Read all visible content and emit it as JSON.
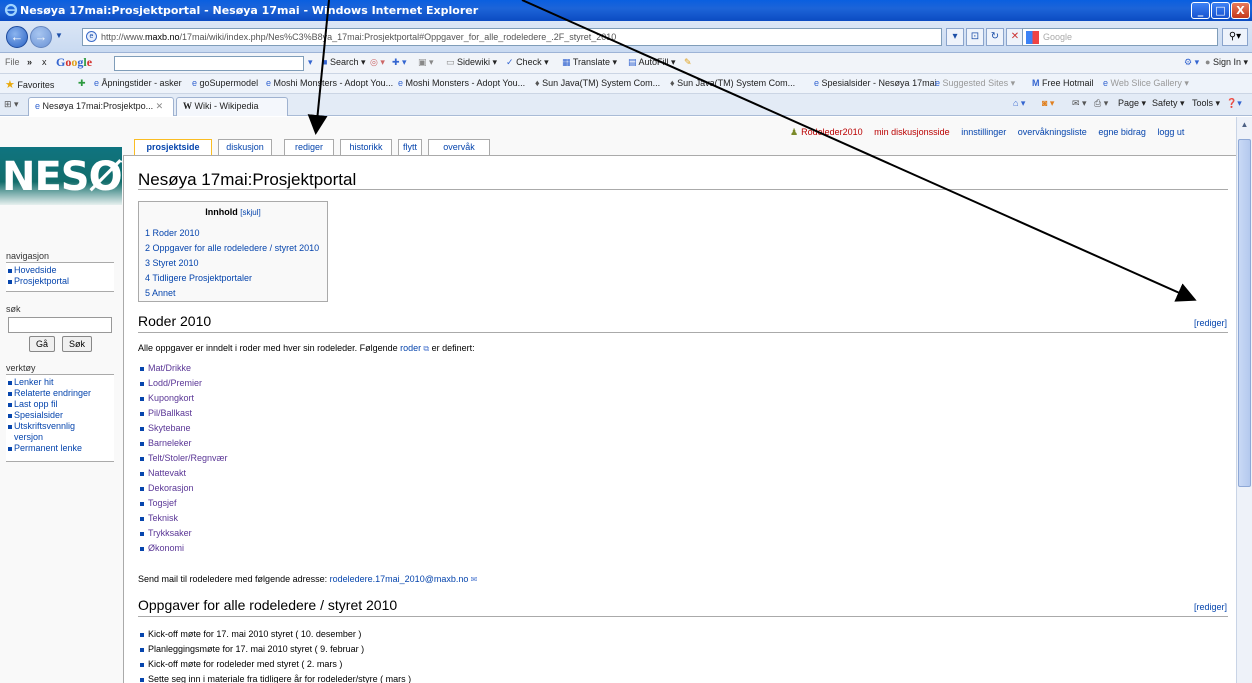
{
  "window": {
    "title": "Nesøya 17mai:Prosjektportal - Nesøya 17mai - Windows Internet Explorer",
    "min": "_",
    "max": "□",
    "close": "X"
  },
  "addressbar": {
    "url_prefix": "http://www.",
    "url_domain": "maxb.no",
    "url_rest": "/17mai/wiki/index.php/Nes%C3%B8ya_17mai:Prosjektportal#Oppgaver_for_alle_rodeledere_.2F_styret_2010",
    "search_placeholder": "Google"
  },
  "toolbar": {
    "file": "File",
    "more": "»",
    "close_x": "x",
    "google_logo": [
      "G",
      "o",
      "o",
      "g",
      "l",
      "e"
    ],
    "search": "Search",
    "sidewiki": "Sidewiki",
    "check": "Check",
    "translate": "Translate",
    "autofill": "AutoFill",
    "sign_in": "Sign In"
  },
  "favorites": {
    "label": "Favorites",
    "items": [
      "Åpningstider - asker",
      "goSupermodel",
      "Moshi Monsters - Adopt You...",
      "Moshi Monsters - Adopt You...",
      "Sun Java(TM) System Com...",
      "Sun Java(TM) System Com...",
      "Spesialsider - Nesøya 17mai",
      "Suggested Sites",
      "Free Hotmail",
      "Web Slice Gallery"
    ]
  },
  "tabs": {
    "items": [
      "Nesøya 17mai:Prosjektpo...",
      "Wiki - Wikipedia"
    ],
    "page": "Page",
    "safety": "Safety",
    "tools": "Tools"
  },
  "personal": {
    "items": [
      "Rodeleder2010",
      "min diskusjonsside",
      "innstillinger",
      "overvåkningsliste",
      "egne bidrag",
      "logg ut"
    ]
  },
  "logo": {
    "text": "NESØYA"
  },
  "page_tabs": [
    "prosjektside",
    "diskusjon",
    "rediger",
    "historikk",
    "flytt",
    "overvåk"
  ],
  "sidebar": {
    "nav_heading": "navigasjon",
    "nav_items": [
      "Hovedside",
      "Prosjektportal"
    ],
    "search_heading": "søk",
    "go": "Gå",
    "search": "Søk",
    "tools_heading": "verktøy",
    "tools_items": [
      "Lenker hit",
      "Relaterte endringer",
      "Last opp fil",
      "Spesialsider",
      "Utskriftsvennlig",
      "versjon",
      "Permanent lenke"
    ]
  },
  "content": {
    "title": "Nesøya 17mai:Prosjektportal",
    "toc": {
      "title": "Innhold",
      "hide": "[skjul]",
      "items": [
        "1 Roder 2010",
        "2 Oppgaver for alle rodeledere / styret 2010",
        "3 Styret 2010",
        "4 Tidligere Prosjektportaler",
        "5 Annet"
      ]
    },
    "section1": {
      "heading": "Roder 2010",
      "edit": "[rediger]",
      "intro_before": "Alle oppgaver er inndelt i roder med hver sin rodeleder. Følgende",
      "intro_link": "roder",
      "intro_after": "er definert:",
      "items": [
        "Mat/Drikke",
        "Lodd/Premier",
        "Kupongkort",
        "Pil/Ballkast",
        "Skytebane",
        "Barneleker",
        "Telt/Stoler/Regnvær",
        "Nattevakt",
        "Dekorasjon",
        "Togsjef",
        "Teknisk",
        "Trykksaker",
        "Økonomi"
      ],
      "mail_before": "Send mail til rodeledere med følgende adresse:",
      "mail_link": "rodeledere.17mai_2010@maxb.no"
    },
    "section2": {
      "heading": "Oppgaver for alle rodeledere / styret 2010",
      "edit": "[rediger]",
      "items": [
        "Kick-off møte for 17. mai 2010 styret ( 10. desember )",
        "Planleggingsmøte for 17. mai 2010 styret ( 9. februar )",
        "Kick-off møte for rodeleder med styret ( 2. mars )",
        "Sette seg inn i materiale fra tidligere år for rodeleder/styre ( mars )"
      ]
    }
  },
  "colors": {
    "link": "#0645ad",
    "visited": "#5a3696",
    "title_bar": "#0b4bc2",
    "tab_selected_border": "#fabd23"
  }
}
